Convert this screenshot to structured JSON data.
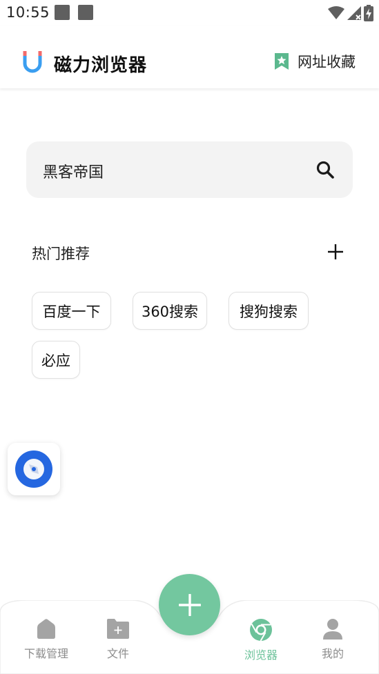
{
  "status_bar": {
    "time": "10:55"
  },
  "app_bar": {
    "title": "磁力浏览器",
    "bookmark_label": "网址收藏"
  },
  "search": {
    "value": "黑客帝国"
  },
  "hot": {
    "title": "热门推荐",
    "tags": [
      {
        "label": "百度一下"
      },
      {
        "label": "360搜索"
      },
      {
        "label": "搜狗搜索"
      },
      {
        "label": "必应"
      }
    ]
  },
  "bottom_nav": {
    "items": [
      {
        "label": "下载管理",
        "icon": "home-icon"
      },
      {
        "label": "文件",
        "icon": "folder-add-icon"
      },
      {
        "label": "浏览器",
        "icon": "chrome-icon",
        "active": true
      },
      {
        "label": "我的",
        "icon": "person-icon"
      }
    ]
  },
  "colors": {
    "accent": "#73c79f",
    "active_label": "#6cc29a",
    "inactive": "#8c8c8c"
  }
}
